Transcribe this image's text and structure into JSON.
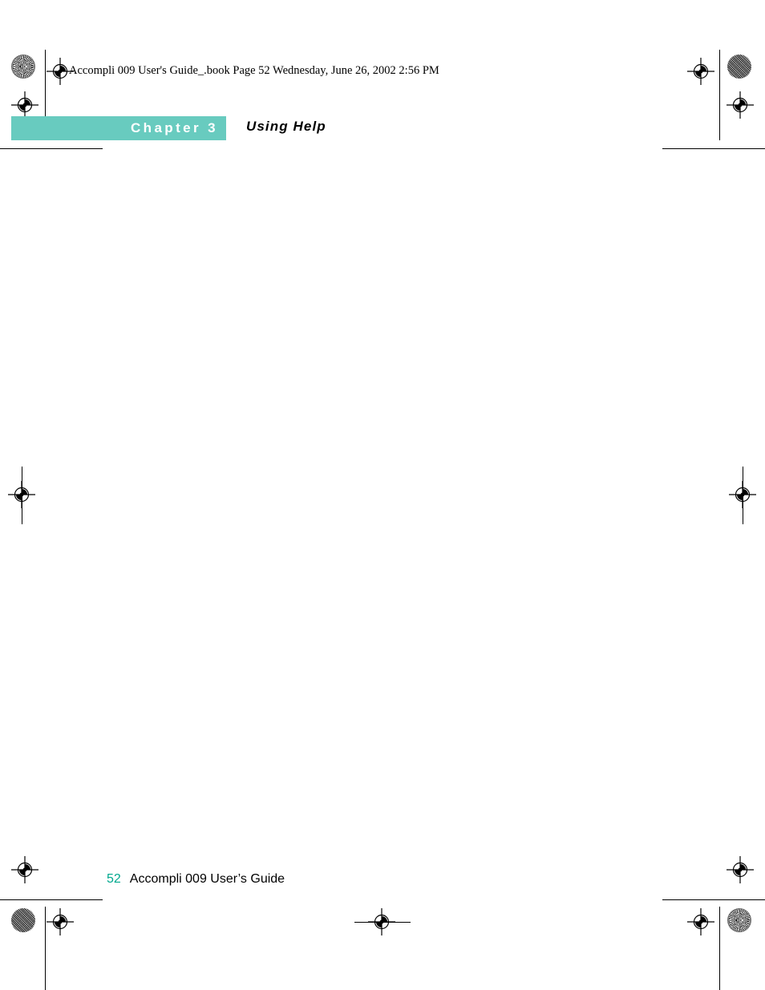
{
  "document": {
    "header_line": "Accompli 009 User's Guide_.book  Page 52  Wednesday, June 26, 2002  2:56 PM",
    "chapter_label": "Chapter 3",
    "chapter_title": "Using Help",
    "body_text": ""
  },
  "footer": {
    "page_number": "52",
    "doc_title": "Accompli 009 User’s Guide"
  },
  "colors": {
    "chapter_bar": "#68cbbf",
    "page_number": "#00a88e",
    "text": "#000000",
    "page_background": "#ffffff"
  }
}
